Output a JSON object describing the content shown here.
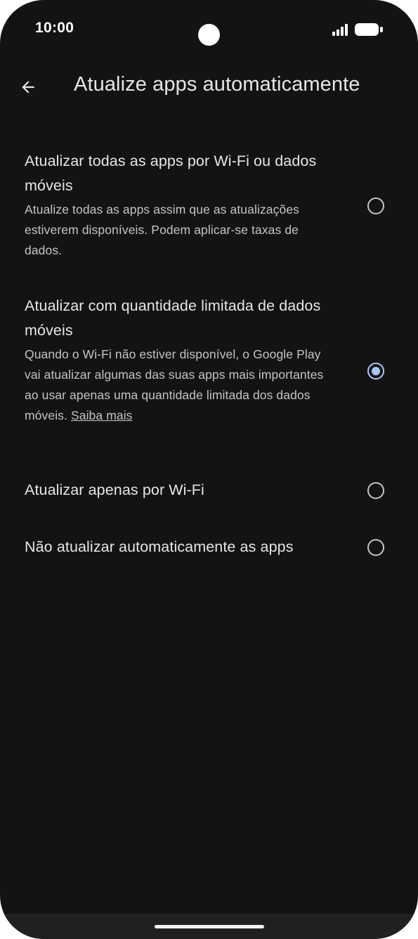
{
  "status_bar": {
    "time": "10:00",
    "icons": [
      "signal-icon",
      "battery-icon"
    ]
  },
  "app_bar": {
    "back_icon": "arrow-left-icon",
    "title": "Atualize apps automaticamente"
  },
  "options": [
    {
      "title": "Atualizar todas as apps por Wi-Fi ou dados móveis",
      "description": "Atualize todas as apps assim que as atualizações estiverem disponíveis. Podem aplicar-se taxas de dados.",
      "selected": false
    },
    {
      "title": "Atualizar com quantidade limitada de dados móveis",
      "description": "Quando o Wi-Fi não estiver disponível, o Google Play vai atualizar algumas das suas apps mais importantes ao usar apenas uma quantidade limitada dos dados móveis.",
      "link": "Saiba mais",
      "selected": true
    },
    {
      "title": "Atualizar apenas por Wi-Fi",
      "selected": false
    },
    {
      "title": "Não atualizar automaticamente as apps",
      "selected": false
    }
  ],
  "colors": {
    "background": "#131313",
    "text_primary": "#e6e6e6",
    "text_secondary": "#c4c4c4",
    "radio_selected": "#a8c7fa",
    "radio_unselected": "#c6c6c6"
  }
}
